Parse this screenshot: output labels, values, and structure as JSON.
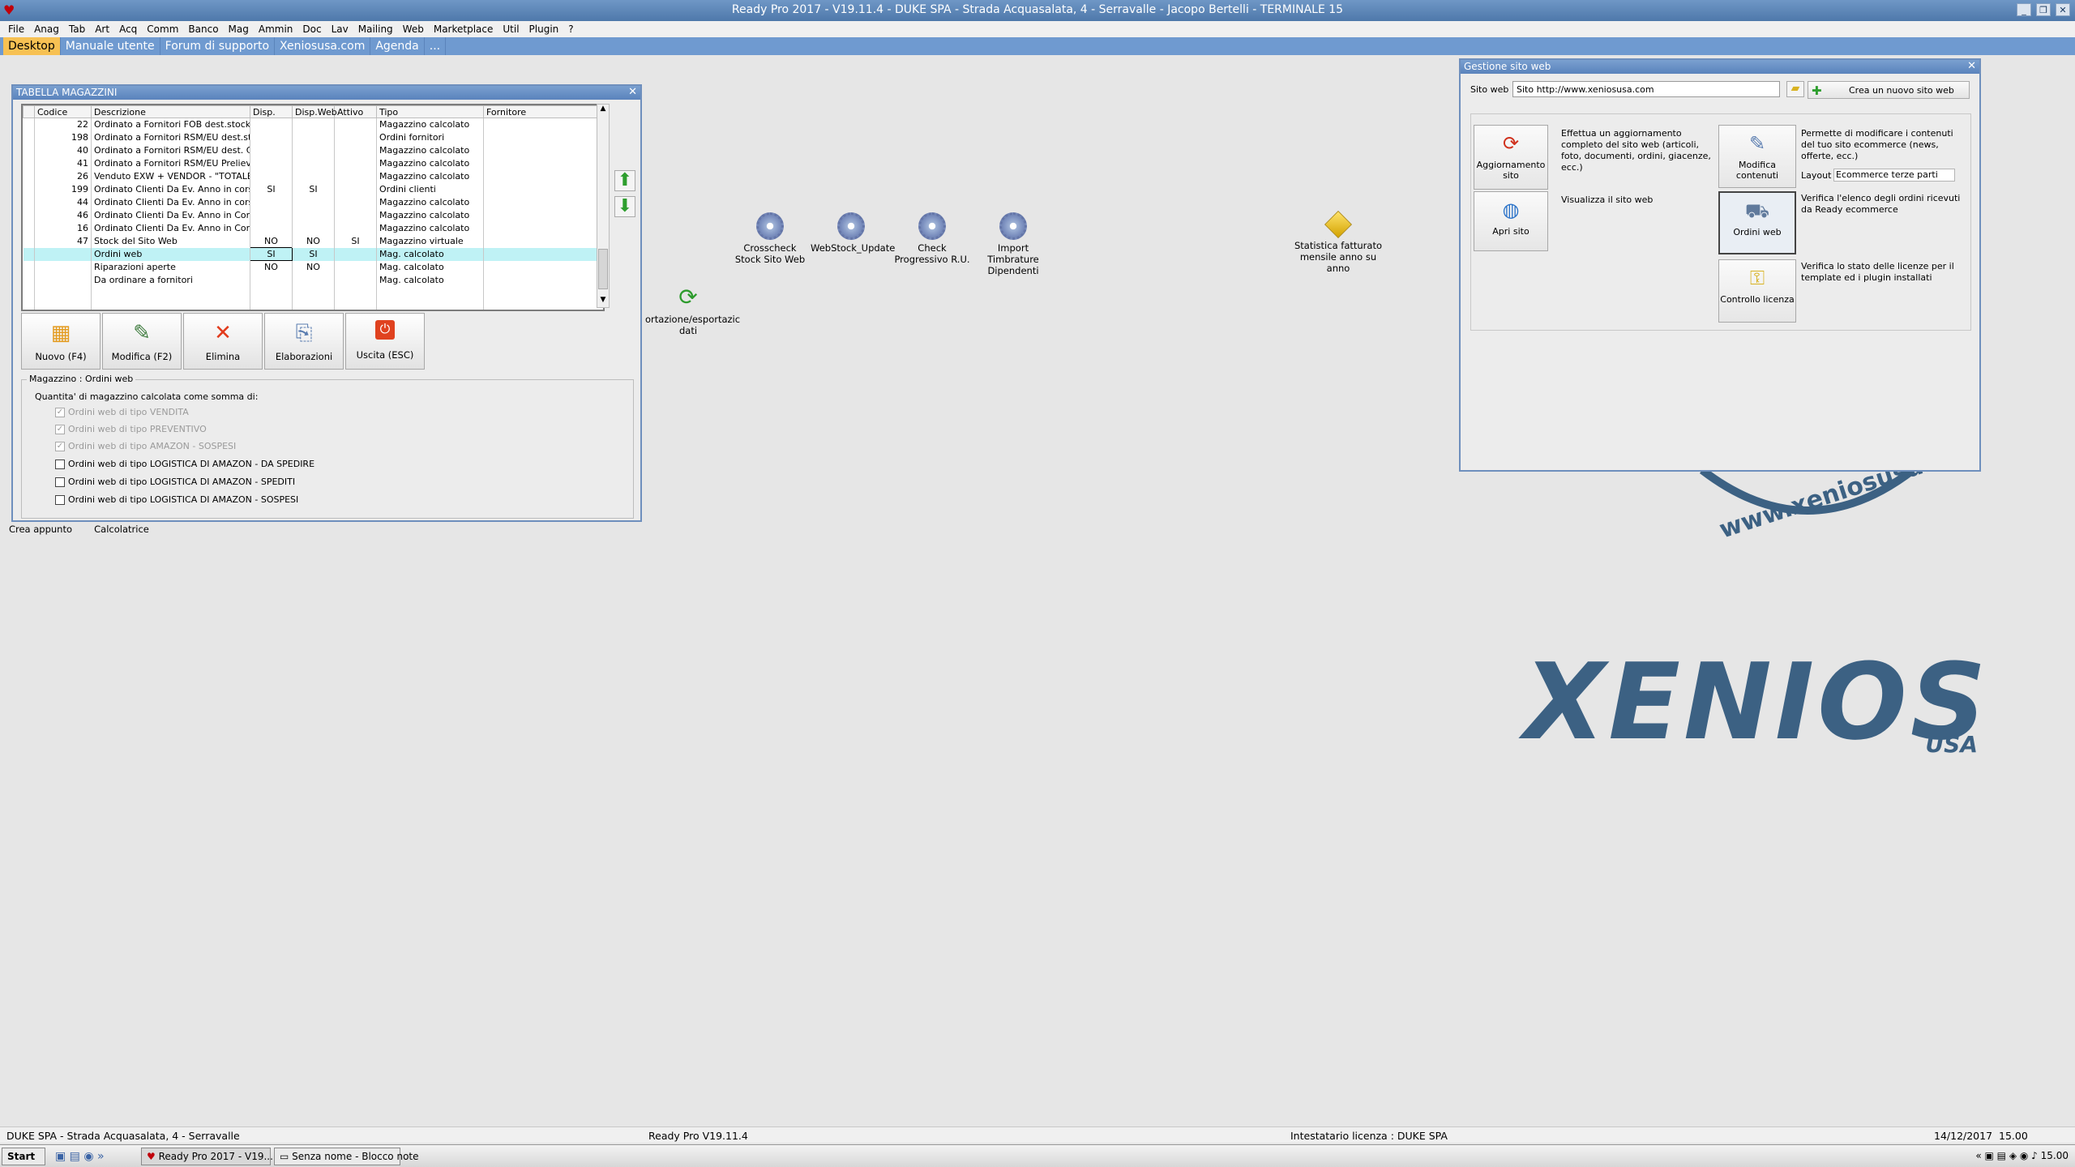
{
  "window": {
    "title": "Ready Pro 2017 - V19.11.4 - DUKE SPA - Strada Acquasalata, 4 - Serravalle - Jacopo Bertelli - TERMINALE 15"
  },
  "menu": [
    "File",
    "Anag",
    "Tab",
    "Art",
    "Acq",
    "Comm",
    "Banco",
    "Mag",
    "Ammin",
    "Doc",
    "Lav",
    "Mailing",
    "Web",
    "Marketplace",
    "Util",
    "Plugin",
    "?"
  ],
  "tabs": [
    "Desktop",
    "Manuale utente",
    "Forum di supporto",
    "Xeniosusa.com",
    "Agenda",
    "..."
  ],
  "desktop_icons": [
    {
      "label": "Crosscheck Stock Sito Web",
      "icon": "gear-icon"
    },
    {
      "label": "WebStock_Update",
      "icon": "gear-icon"
    },
    {
      "label": "Check Progressivo R.U.",
      "icon": "gear-icon"
    },
    {
      "label": "Import Timbrature Dipendenti",
      "icon": "gear-icon"
    },
    {
      "label": "Statistica fatturato mensile anno su anno",
      "icon": "cube-icon"
    },
    {
      "label": "ortazione/esportazic dati",
      "icon": "import-export-icon"
    },
    {
      "label": "Crea appunto",
      "icon": "note-icon"
    },
    {
      "label": "Calcolatrice",
      "icon": "calculator-icon"
    }
  ],
  "magazzini": {
    "title": "TABELLA MAGAZZINI",
    "columns": [
      "Codice",
      "Descrizione",
      "Disp.",
      "Disp.Web",
      "Attivo",
      "Tipo",
      "Fornitore"
    ],
    "rows": [
      [
        "22",
        "Ordinato a Fornitori FOB dest.stock ...",
        "",
        "",
        "",
        "Magazzino calcolato",
        ""
      ],
      [
        "198",
        "Ordinato a Fornitori RSM/EU dest.sto...",
        "",
        "",
        "",
        "Ordini fornitori",
        ""
      ],
      [
        "40",
        "Ordinato a Fornitori RSM/EU dest. CO",
        "",
        "",
        "",
        "Magazzino calcolato",
        ""
      ],
      [
        "41",
        "Ordinato a Fornitori RSM/EU Prelievo ...",
        "",
        "",
        "",
        "Magazzino calcolato",
        ""
      ],
      [
        "26",
        "Venduto EXW + VENDOR - \"TOTALE ...",
        "",
        "",
        "",
        "Magazzino calcolato",
        ""
      ],
      [
        "199",
        "Ordinato Clienti Da Ev. Anno in corso...",
        "SI",
        "SI",
        "",
        "Ordini clienti",
        ""
      ],
      [
        "44",
        "Ordinato Clienti Da Ev. Anno in corso...",
        "",
        "",
        "",
        "Magazzino calcolato",
        ""
      ],
      [
        "46",
        "Ordinato Clienti Da Ev. Anno in Corso...",
        "",
        "",
        "",
        "Magazzino calcolato",
        ""
      ],
      [
        "16",
        "Ordinato Clienti Da Ev. Anno in Corso...",
        "",
        "",
        "",
        "Magazzino calcolato",
        ""
      ],
      [
        "47",
        "Stock del Sito Web",
        "NO",
        "NO",
        "SI",
        "Magazzino virtuale",
        ""
      ],
      [
        "",
        "Ordini web",
        "SI",
        "SI",
        "",
        "Mag. calcolato",
        ""
      ],
      [
        "",
        "Riparazioni aperte",
        "NO",
        "NO",
        "",
        "Mag. calcolato",
        ""
      ],
      [
        "",
        "Da ordinare a fornitori",
        "",
        "",
        "",
        "Mag. calcolato",
        ""
      ]
    ],
    "toolbar": {
      "nuovo": "Nuovo (F4)",
      "modifica": "Modifica (F2)",
      "elimina": "Elimina",
      "elaborazioni": "Elaborazioni",
      "uscita": "Uscita (ESC)"
    },
    "group_title": "Magazzino : Ordini web",
    "subtitle": "Quantita' di magazzino calcolata come somma di:",
    "options": [
      {
        "label": "Ordini web di tipo VENDITA",
        "checked": true,
        "disabled": true
      },
      {
        "label": "Ordini web di tipo PREVENTIVO",
        "checked": true,
        "disabled": true
      },
      {
        "label": "Ordini web di tipo AMAZON - SOSPESI",
        "checked": true,
        "disabled": true
      },
      {
        "label": "Ordini web di tipo LOGISTICA DI AMAZON - DA SPEDIRE",
        "checked": false,
        "disabled": false
      },
      {
        "label": "Ordini web di tipo LOGISTICA DI AMAZON - SPEDITI",
        "checked": false,
        "disabled": false
      },
      {
        "label": "Ordini web di tipo LOGISTICA DI AMAZON - SOSPESI",
        "checked": false,
        "disabled": false
      }
    ]
  },
  "gestione": {
    "title": "Gestione sito web",
    "sito_label": "Sito web :",
    "sito_value": "Sito http://www.xeniosusa.com",
    "crea_button": "Crea un nuovo sito web",
    "buttons": {
      "aggiornamento": "Aggiornamento sito",
      "apri": "Apri sito",
      "modifica": "Modifica contenuti",
      "ordini": "Ordini web",
      "licenza": "Controllo licenza"
    },
    "desc": {
      "aggiornamento": "Effettua un aggiornamento completo del sito web (articoli, foto, documenti, ordini, giacenze, ecc.)",
      "apri": "Visualizza il sito web",
      "modifica": "Permette di modificare i contenuti del tuo sito ecommerce (news, offerte, ecc.)",
      "ordini": "Verifica l'elenco degli ordini ricevuti da Ready ecommerce",
      "licenza": "Verifica lo stato delle licenze per il template ed i plugin installati"
    },
    "layout_label": "Layout :",
    "layout_value": "Ecommerce terze parti"
  },
  "logo": {
    "url_text": "www.xeniosusa.com",
    "brand": "XENIOS",
    "sub": "USA"
  },
  "status": {
    "left": "DUKE SPA - Strada Acquasalata, 4 - Serravalle",
    "center": "Ready Pro V19.11.4",
    "licenza": "Intestatario licenza : DUKE SPA",
    "date": "14/12/2017",
    "time": "15.00"
  },
  "taskbar": {
    "start": "Start",
    "app1": "Ready Pro 2017 - V19...",
    "app2": "Senza nome - Blocco note",
    "clock": "15.00"
  },
  "colors": {
    "title_bar": "#5a83bc",
    "tab_active": "#f7c153",
    "logo": "#3c6183",
    "selected_row": "#bff2f5"
  }
}
